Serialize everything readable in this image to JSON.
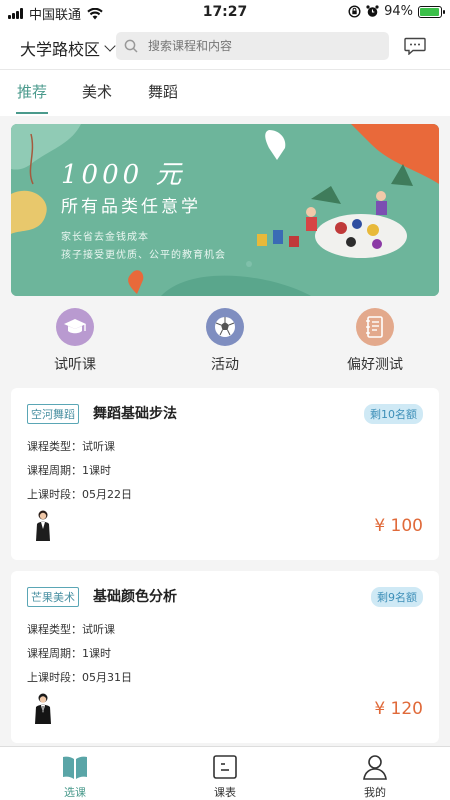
{
  "status_bar": {
    "carrier": "中国联通",
    "time": "17:27",
    "battery_percent": "94%",
    "battery_level": 0.94
  },
  "header": {
    "campus": "大学路校区",
    "search_placeholder": "搜索课程和内容"
  },
  "tabs": [
    {
      "label": "推荐",
      "active": true
    },
    {
      "label": "美术",
      "active": false
    },
    {
      "label": "舞蹈",
      "active": false
    }
  ],
  "banner": {
    "headline": "1000 元",
    "subhead": "所有品类任意学",
    "line1": "家长省去金钱成本",
    "line2": "孩子接受更优质、公平的教育机会"
  },
  "quick_entries": [
    {
      "label": "试听课",
      "icon": "graduation-cap-icon",
      "color": "#b99ad0"
    },
    {
      "label": "活动",
      "icon": "soccer-ball-icon",
      "color": "#7f8ec0"
    },
    {
      "label": "偏好测试",
      "icon": "notebook-icon",
      "color": "#e3a98c"
    }
  ],
  "courses": [
    {
      "tag": "空河舞蹈",
      "title": "舞蹈基础步法",
      "quota": "剩10名额",
      "type": "课程类型：试听课",
      "period": "课程周期：1课时",
      "session": "上课时段：05月22日",
      "price": "¥ 100"
    },
    {
      "tag": "芒果美术",
      "title": "基础颜色分析",
      "quota": "剩9名额",
      "type": "课程类型：试听课",
      "period": "课程周期：1课时",
      "session": "上课时段：05月31日",
      "price": "¥ 120"
    }
  ],
  "bottom_nav": [
    {
      "label": "选课",
      "icon": "book-icon",
      "active": true
    },
    {
      "label": "课表",
      "icon": "schedule-icon",
      "active": false
    },
    {
      "label": "我的",
      "icon": "user-icon",
      "active": false
    }
  ],
  "colors": {
    "accent": "#4a9a8c",
    "price": "#e06a3a",
    "banner_bg": "#6db59b"
  }
}
